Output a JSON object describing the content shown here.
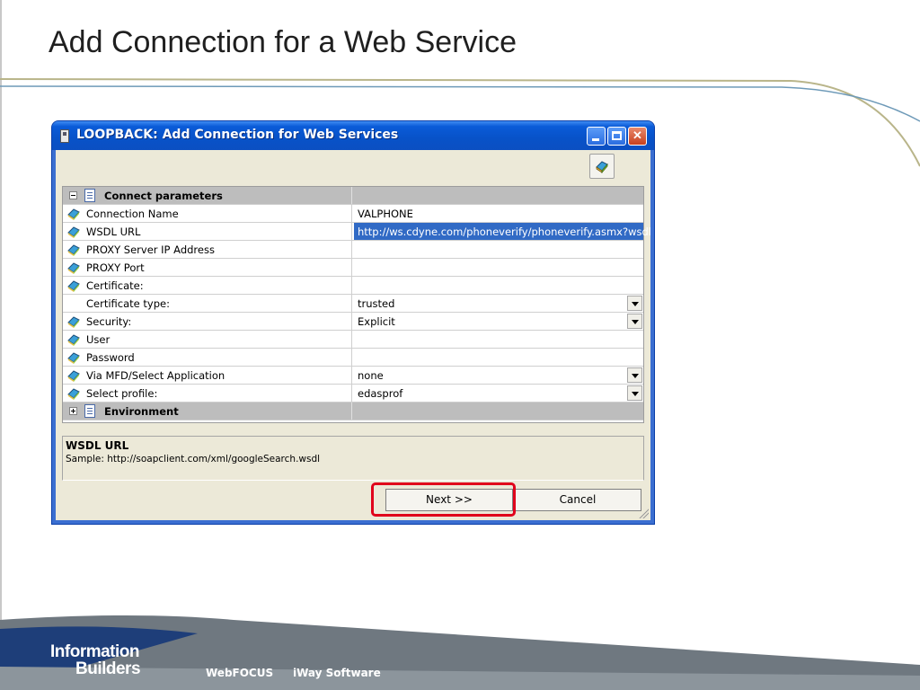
{
  "slide": {
    "title": "Add Connection for a Web Service"
  },
  "window": {
    "title": "LOOPBACK: Add Connection for Web Services",
    "title_bar_color": "#0a5bd8"
  },
  "grid": {
    "group_connect": "Connect parameters",
    "group_environment": "Environment",
    "rows": [
      {
        "label": "Connection Name",
        "value": "VALPHONE",
        "icon": "tool-icon"
      },
      {
        "label": "WSDL URL",
        "value": "http://ws.cdyne.com/phoneverify/phoneverify.asmx?wsdl",
        "icon": "tool-icon",
        "selected": true
      },
      {
        "label": "PROXY Server IP Address",
        "value": "",
        "icon": "tool-icon"
      },
      {
        "label": "PROXY Port",
        "value": "",
        "icon": "tool-icon"
      },
      {
        "label": "Certificate:",
        "value": "",
        "icon": "tool-icon"
      },
      {
        "label": "Certificate type:",
        "value": "trusted",
        "dropdown": true
      },
      {
        "label": "Security:",
        "value": "Explicit",
        "icon": "tool-icon",
        "dropdown": true
      },
      {
        "label": "User",
        "value": "",
        "icon": "tool-icon"
      },
      {
        "label": "Password",
        "value": "",
        "icon": "tool-icon"
      },
      {
        "label": "Via MFD/Select Application",
        "value": "none",
        "icon": "tool-icon",
        "dropdown": true
      },
      {
        "label": "Select profile:",
        "value": "edasprof",
        "icon": "tool-icon",
        "dropdown": true
      }
    ]
  },
  "description": {
    "title": "WSDL URL",
    "text": "Sample: http://soapclient.com/xml/googleSearch.wsdl"
  },
  "buttons": {
    "next": "Next >>",
    "cancel": "Cancel"
  },
  "highlight_color": "#e0001b",
  "footer": {
    "logo_line1": "Information",
    "logo_line2": "Builders",
    "product1": "WebFOCUS",
    "product2": "iWay Software"
  }
}
